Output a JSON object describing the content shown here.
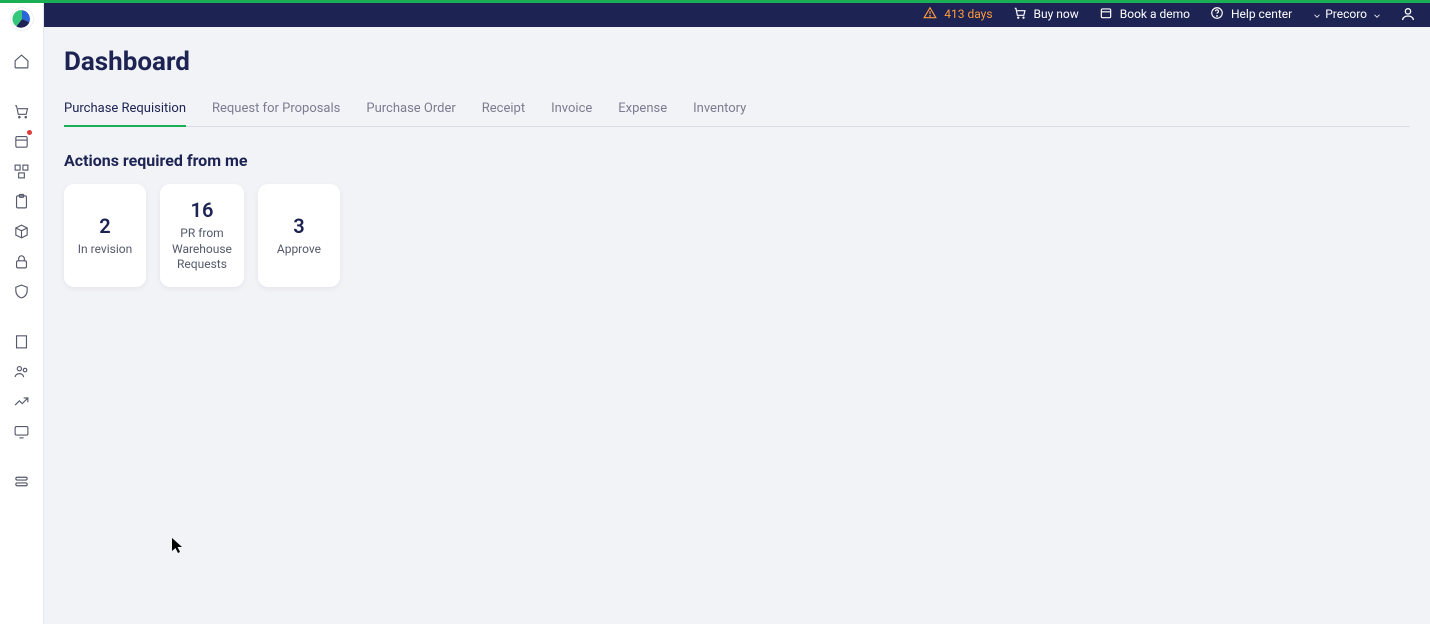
{
  "header": {
    "trial_days": "413 days",
    "buy_now": "Buy now",
    "book_demo": "Book a demo",
    "help_center": "Help center",
    "company": "Precoro"
  },
  "page_title": "Dashboard",
  "tabs": [
    {
      "label": "Purchase Requisition",
      "active": true
    },
    {
      "label": "Request for Proposals",
      "active": false
    },
    {
      "label": "Purchase Order",
      "active": false
    },
    {
      "label": "Receipt",
      "active": false
    },
    {
      "label": "Invoice",
      "active": false
    },
    {
      "label": "Expense",
      "active": false
    },
    {
      "label": "Inventory",
      "active": false
    }
  ],
  "section_title": "Actions required from me",
  "action_cards": [
    {
      "count": "2",
      "label": "In revision"
    },
    {
      "count": "16",
      "label": "PR from\nWarehouse\nRequests"
    },
    {
      "count": "3",
      "label": "Approve"
    }
  ],
  "sidebar_items": [
    "home",
    "cart",
    "calendar",
    "boxes",
    "clipboard",
    "package",
    "lock",
    "shield"
  ],
  "sidebar_items2": [
    "building",
    "users",
    "chart",
    "display"
  ],
  "sidebar_items3": [
    "settings"
  ]
}
